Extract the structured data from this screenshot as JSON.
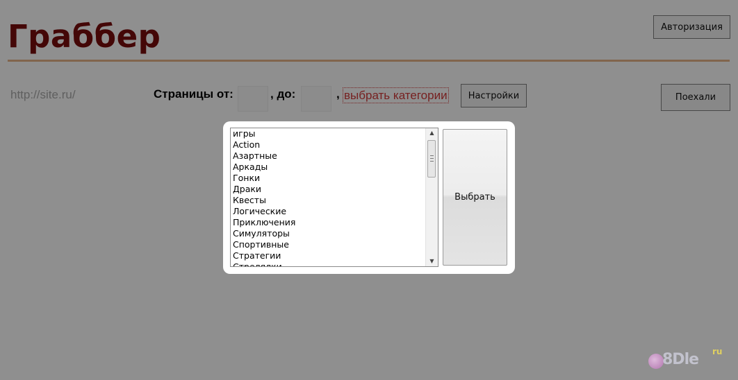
{
  "header": {
    "title": "Граббер",
    "auth_button": "Авторизация"
  },
  "form": {
    "url_placeholder": "http://site.ru/",
    "pages_from_label": "Страницы от:",
    "pages_to_label": ", до:",
    "comma": ",",
    "choose_categories_link": "выбрать категории",
    "settings_button": "Настройки",
    "go_button": "Поехали"
  },
  "dialog": {
    "categories": [
      "игры",
      "Action",
      "Азартные",
      "Аркады",
      "Гонки",
      "Драки",
      "Квесты",
      "Логические",
      "Приключения",
      "Симуляторы",
      "Спортивные",
      "Стратегии",
      "Стрелялки"
    ],
    "choose_button": "Выбрать"
  },
  "watermark": {
    "text": "8Dle",
    "suffix": "ru"
  },
  "colors": {
    "title": "#7a0d0d",
    "rule": "#e7b58a",
    "link": "#d33a3a"
  }
}
